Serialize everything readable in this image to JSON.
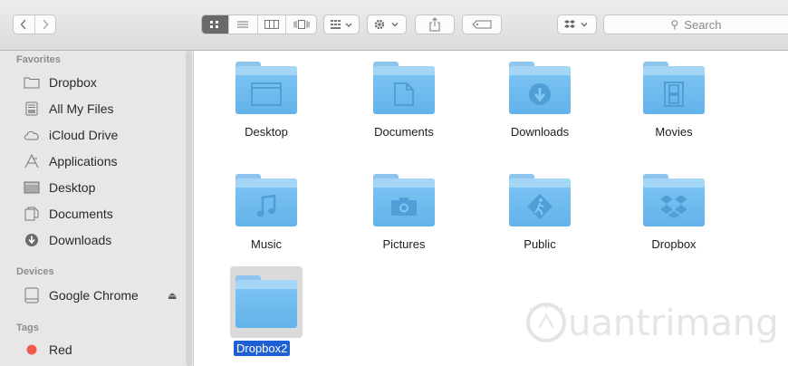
{
  "toolbar": {
    "back_icon": "chevron-left-icon",
    "forward_icon": "chevron-right-icon",
    "view_modes": [
      "icon-view",
      "list-view",
      "column-view",
      "coverflow-view"
    ],
    "active_view": "icon-view",
    "search_placeholder": "Search"
  },
  "sidebar": {
    "favorites_heading": "Favorites",
    "favorites": [
      {
        "label": "Dropbox",
        "icon": "folder-icon"
      },
      {
        "label": "All My Files",
        "icon": "all-files-icon"
      },
      {
        "label": "iCloud Drive",
        "icon": "cloud-icon"
      },
      {
        "label": "Applications",
        "icon": "applications-icon"
      },
      {
        "label": "Desktop",
        "icon": "desktop-icon"
      },
      {
        "label": "Documents",
        "icon": "documents-icon"
      },
      {
        "label": "Downloads",
        "icon": "downloads-icon"
      }
    ],
    "devices_heading": "Devices",
    "devices": [
      {
        "label": "Google Chrome",
        "icon": "disk-icon",
        "eject": "⏏"
      }
    ],
    "tags_heading": "Tags",
    "tags": [
      {
        "label": "Red",
        "color": "#f05a4a"
      }
    ]
  },
  "content": {
    "folders": [
      {
        "label": "Desktop",
        "glyph": "desktop"
      },
      {
        "label": "Documents",
        "glyph": "document"
      },
      {
        "label": "Downloads",
        "glyph": "download"
      },
      {
        "label": "Movies",
        "glyph": "film"
      },
      {
        "label": "Music",
        "glyph": "music"
      },
      {
        "label": "Pictures",
        "glyph": "camera"
      },
      {
        "label": "Public",
        "glyph": "public"
      },
      {
        "label": "Dropbox",
        "glyph": "dropbox"
      },
      {
        "label": "Dropbox2",
        "glyph": "none",
        "selected": true,
        "renaming": true
      }
    ]
  },
  "watermark": {
    "text": "uantrimang"
  },
  "colors": {
    "folder": "#6cb9ee",
    "selection": "#1e5fd3",
    "sidebar": "#e7e7e7"
  }
}
